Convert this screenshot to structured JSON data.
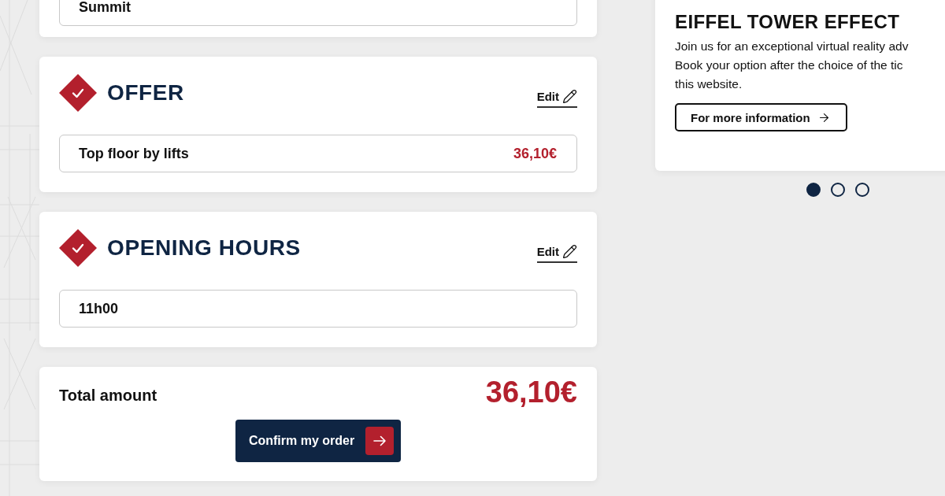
{
  "sections": [
    {
      "kind": "field_only",
      "value": "Summit"
    },
    {
      "kind": "step",
      "done": true,
      "title": "OFFER",
      "edit_label": "Edit",
      "value": "Top floor by lifts",
      "price": "36,10€"
    },
    {
      "kind": "step",
      "done": true,
      "title": "OPENING HOURS",
      "edit_label": "Edit",
      "value": "11h00"
    }
  ],
  "total": {
    "label": "Total amount",
    "amount": "36,10€",
    "confirm_label": "Confirm my order"
  },
  "promo": {
    "title": "EIFFEL TOWER EFFECT",
    "lines": [
      "Join us for an exceptional virtual reality adv",
      "Book your option after the choice of the tic",
      "this website."
    ],
    "link_label": "For more information",
    "slides": [
      {
        "selected": true
      },
      {
        "selected": false
      },
      {
        "selected": false
      }
    ]
  }
}
